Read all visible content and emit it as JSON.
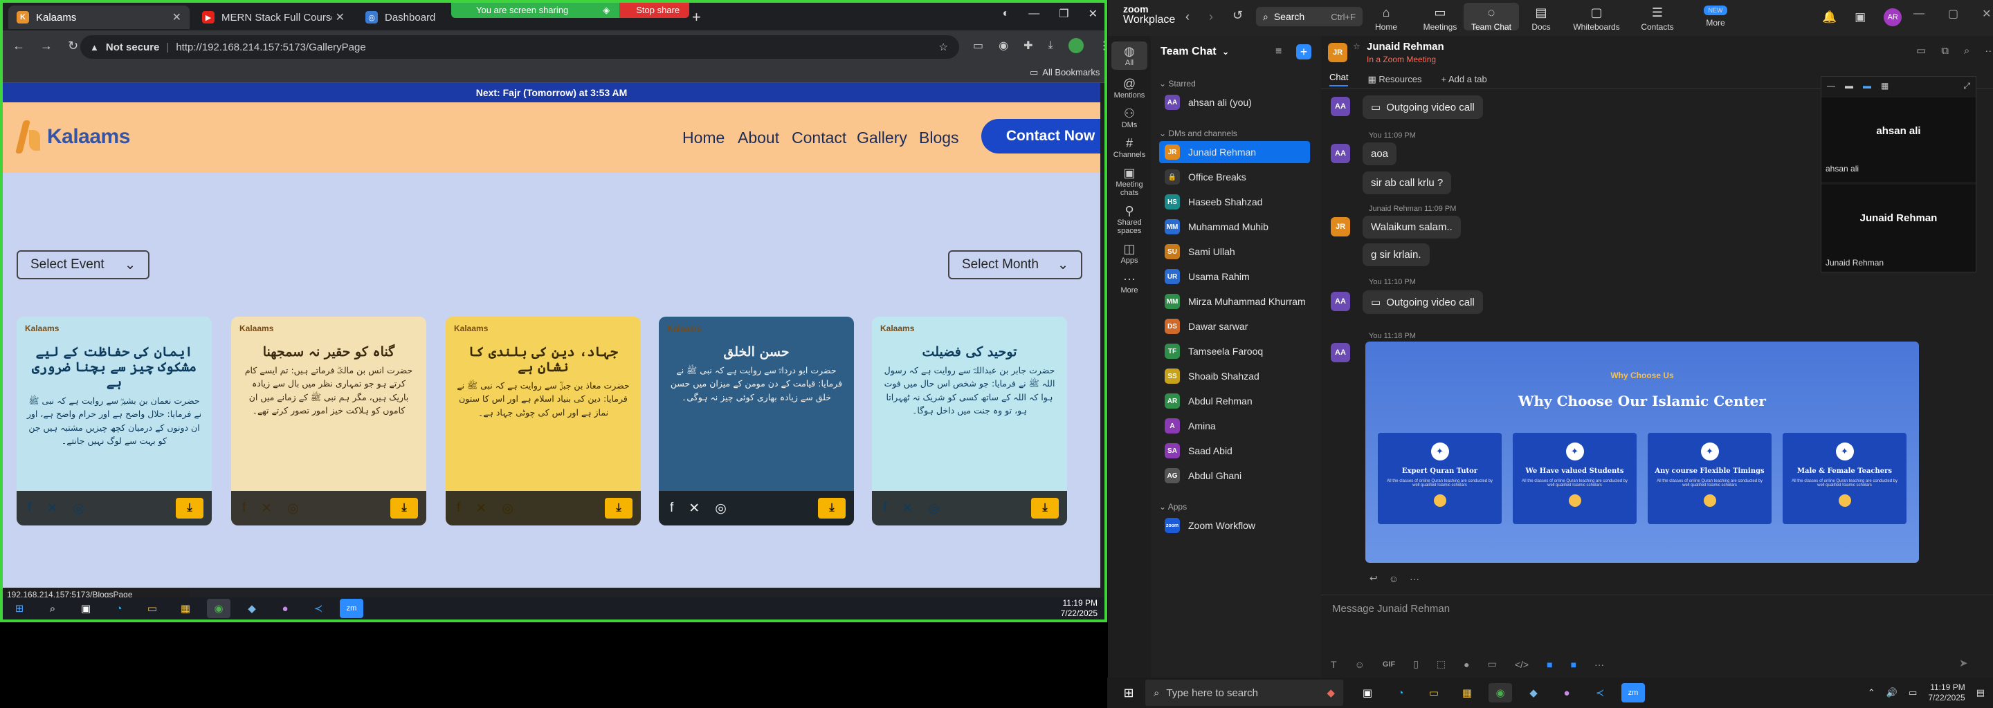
{
  "browser": {
    "tabs": [
      {
        "label": "Kalaams",
        "active": true
      },
      {
        "label": "MERN Stack Full Course - ECom",
        "active": false
      },
      {
        "label": "Dashboard",
        "active": false
      }
    ],
    "share_banner": "You are screen sharing",
    "stop_share": "Stop share",
    "not_secure": "Not secure",
    "url": "http://192.168.214.157:5173/GalleryPage",
    "all_bookmarks": "All Bookmarks",
    "status_url": "192.168.214.157:5173/BlogsPage"
  },
  "site": {
    "prayer_banner": "Next: Fajr (Tomorrow) at 3:53 AM",
    "logo": "Kalaams",
    "nav": {
      "home": "Home",
      "about": "About",
      "contact": "Contact",
      "gallery": "Gallery",
      "blogs": "Blogs",
      "cta": "Contact Now"
    },
    "select_event": "Select Event",
    "select_month": "Select Month",
    "cards": [
      {
        "title": "ایمان کی حفاظت کے لیے مشکوک چیز سے بچنا ضروری ہے",
        "body": "حضرت نعمان بن بشیرؓ سے روایت ہے کہ نبی ﷺ نے فرمایا: حلال واضح ہے اور حرام واضح ہے، اور ان دونوں کے درمیان کچھ چیزیں مشتبہ ہیں جن کو بہت سے لوگ نہیں جانتے۔",
        "bg": "#bfe3ee",
        "fg": "#0d3b5e"
      },
      {
        "title": "گناہ کو حقیر نہ سمجھنا",
        "body": "حضرت انس بن مالکؓ فرماتے ہیں: تم ایسے کام کرتے ہو جو تمہاری نظر میں بال سے زیادہ باریک ہیں، مگر ہم نبی ﷺ کے زمانے میں ان کاموں کو ہلاکت خیز امور تصور کرتے تھے۔",
        "bg": "#f3e1b4",
        "fg": "#3a2a10"
      },
      {
        "title": "جہاد، دین کی بلندی کا نشان ہے",
        "body": "حضرت معاذ بن جبلؓ سے روایت ہے کہ نبی ﷺ نے فرمایا: دین کی بنیاد اسلام ہے اور اس کا ستون نماز ہے اور اس کی چوٹی جہاد ہے۔",
        "bg": "#f5d35a",
        "fg": "#3a2a00"
      },
      {
        "title": "حسن الخلق",
        "body": "حضرت ابو درداءؓ سے روایت ہے کہ نبی ﷺ نے فرمایا: قیامت کے دن مومن کے میزان میں حسن خلق سے زیادہ بھاری کوئی چیز نہ ہوگی۔",
        "bg": "#2e5d86",
        "fg": "#f2f2f2"
      },
      {
        "title": "توحید کی فضیلت",
        "body": "حضرت جابر بن عبداللہؓ سے روایت ہے کہ رسول اللہ ﷺ نے فرمایا: جو شخص اس حال میں فوت ہوا کہ اللہ کے ساتھ کسی کو شریک نہ ٹھہراتا ہو، تو وہ جنت میں داخل ہوگا۔",
        "bg": "#bde6ef",
        "fg": "#0d3b5e"
      }
    ],
    "card_brand": "Kalaams"
  },
  "left_taskbar": {
    "time": "11:19 PM",
    "date": "7/22/2025"
  },
  "zoom": {
    "brand_top": "zoom",
    "brand": "Workplace",
    "search": "Search",
    "search_shortcut": "Ctrl+F",
    "top_tabs": [
      "Home",
      "Meetings",
      "Team Chat",
      "Docs",
      "Whiteboards",
      "Contacts",
      "More"
    ],
    "new_badge": "NEW",
    "rail": [
      "All",
      "Mentions",
      "DMs",
      "Channels",
      "Meeting chats",
      "Shared spaces",
      "Apps",
      "More"
    ],
    "panel_title": "Team Chat",
    "starred": "Starred",
    "dms": "DMs and channels",
    "apps": "Apps",
    "starred_items": [
      {
        "name": "ahsan ali (you)",
        "initials": "AA",
        "color": "#6b4bb3"
      }
    ],
    "contacts": [
      {
        "name": "Junaid Rehman",
        "initials": "JR",
        "color": "#e08a1e",
        "active": true
      },
      {
        "name": "Office Breaks",
        "initials": "🔒",
        "color": "#3a3a3a"
      },
      {
        "name": "Haseeb Shahzad",
        "initials": "HS",
        "color": "#1a8a8a"
      },
      {
        "name": "Muhammad Muhib",
        "initials": "MM",
        "color": "#2a6bd1"
      },
      {
        "name": "Sami Ullah",
        "initials": "SU",
        "color": "#c77a1a"
      },
      {
        "name": "Usama Rahim",
        "initials": "UR",
        "color": "#2a6bd1"
      },
      {
        "name": "Mirza Muhammad Khurram",
        "initials": "MM",
        "color": "#2f8f4a"
      },
      {
        "name": "Dawar sarwar",
        "initials": "DS",
        "color": "#d06a2a"
      },
      {
        "name": "Tamseela Farooq",
        "initials": "TF",
        "color": "#2f8f4a"
      },
      {
        "name": "Shoaib Shahzad",
        "initials": "SS",
        "color": "#c7a21a"
      },
      {
        "name": "Abdul Rehman",
        "initials": "AR",
        "color": "#2f8f4a"
      },
      {
        "name": "Amina",
        "initials": "A",
        "color": "#8a3ab3"
      },
      {
        "name": "Saad Abid",
        "initials": "SA",
        "color": "#8a3ab3"
      },
      {
        "name": "Abdul Ghani",
        "initials": "AG",
        "color": "#555"
      }
    ],
    "app_item": "Zoom Workflow",
    "chat_name": "Junaid Rehman",
    "chat_status": "In a Zoom Meeting",
    "chat_tabs": [
      "Chat",
      "Resources",
      "Add a tab"
    ],
    "messages": [
      {
        "text": "Outgoing video call"
      },
      {
        "meta": "You 11:09 PM",
        "text": "aoa"
      },
      {
        "text": "sir ab call krlu ?"
      },
      {
        "meta": "Junaid Rehman 11:09 PM",
        "text": "Walaikum salam.."
      },
      {
        "text": "g sir krlain."
      },
      {
        "meta": "You 11:10 PM",
        "text": "Outgoing video call"
      },
      {
        "meta": "You 11:18 PM"
      }
    ],
    "shared": {
      "kicker": "Why Choose Us",
      "title": "Why Choose Our Islamic Center",
      "features": [
        "Expert Quran Tutor",
        "We Have valued Students",
        "Any course Flexible Timings",
        "Male & Female Teachers"
      ],
      "feat_body": "All the classes of online Quran teaching are conducted by well qualified Islamic scholars"
    },
    "video": {
      "p1": "ahsan ali",
      "p1_label": "ahsan ali",
      "p2": "Junaid Rehman",
      "p2_label": "Junaid Rehman"
    },
    "composer_placeholder": "Message Junaid Rehman"
  },
  "win_taskbar": {
    "search": "Type here to search",
    "time": "11:19 PM",
    "date": "7/22/2025"
  }
}
